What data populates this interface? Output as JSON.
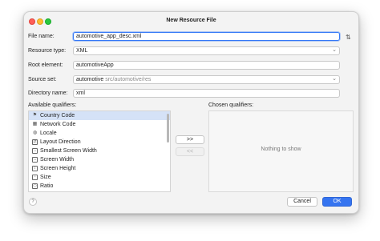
{
  "window": {
    "title": "New Resource File"
  },
  "form": {
    "file_name": {
      "label": "File name:",
      "value": "automotive_app_desc.xml"
    },
    "resource_type": {
      "label": "Resource type:",
      "value": "XML"
    },
    "root_element": {
      "label": "Root element:",
      "value": "automotiveApp"
    },
    "source_set": {
      "label": "Source set:",
      "value": "automotive",
      "path": "src/automotive/res"
    },
    "directory_name": {
      "label": "Directory name:",
      "value": "xml"
    },
    "sort_icon": "sort-arrows-icon"
  },
  "qualifiers": {
    "available_label": "Available qualifiers:",
    "chosen_label": "Chosen qualifiers:",
    "available": [
      {
        "label": "Country Code",
        "icon": "flag-icon",
        "selected": true
      },
      {
        "label": "Network Code",
        "icon": "network-icon",
        "selected": false
      },
      {
        "label": "Locale",
        "icon": "globe-icon",
        "selected": false
      },
      {
        "label": "Layout Direction",
        "icon": "layout-direction-icon",
        "selected": false
      },
      {
        "label": "Smallest Screen Width",
        "icon": "smallest-width-icon",
        "selected": false
      },
      {
        "label": "Screen Width",
        "icon": "screen-width-icon",
        "selected": false
      },
      {
        "label": "Screen Height",
        "icon": "screen-height-icon",
        "selected": false
      },
      {
        "label": "Size",
        "icon": "size-icon",
        "selected": false
      },
      {
        "label": "Ratio",
        "icon": "ratio-icon",
        "selected": false
      }
    ],
    "add_label": ">>",
    "remove_label": "<<",
    "empty_text": "Nothing to show"
  },
  "footer": {
    "help_label": "?",
    "cancel_label": "Cancel",
    "ok_label": "OK"
  },
  "colors": {
    "accent": "#3574f0",
    "selection": "#d5e2f7"
  }
}
